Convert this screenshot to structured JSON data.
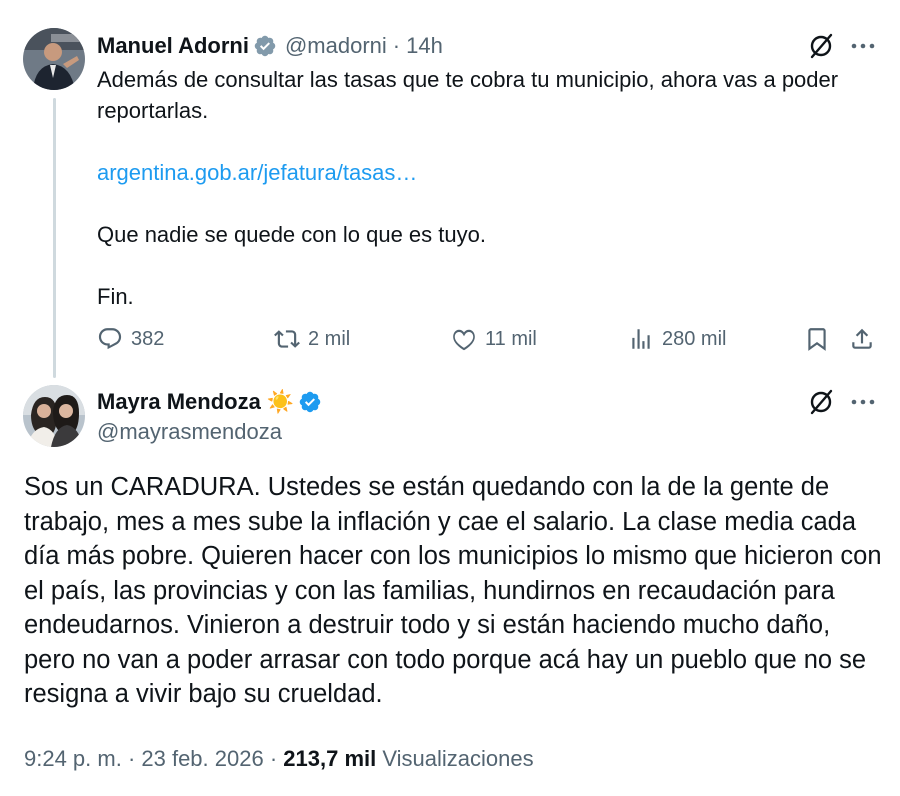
{
  "parent_tweet": {
    "author_name": "Manuel Adorni",
    "handle": "@madorni",
    "separator": "·",
    "time": "14h",
    "lines": [
      "Además de consultar las tasas que te cobra tu municipio, ahora vas a poder reportarlas.",
      "argentina.gob.ar/jefatura/tasas…",
      "Que nadie se quede con lo que es tuyo.",
      "Fin."
    ],
    "actions": {
      "replies": "382",
      "reposts": "2 mil",
      "likes": "11 mil",
      "views": "280 mil"
    }
  },
  "main_tweet": {
    "author_name": "Mayra Mendoza",
    "name_emoji": "☀️",
    "handle": "@mayrasmendoza",
    "text": "Sos un CARADURA. Ustedes se están quedando con la de la gente de trabajo, mes a mes sube la inflación y cae el salario. La clase media cada día más pobre. Quieren hacer con los municipios lo mismo que hicieron con el país, las provincias y con las familias, hundirnos en recaudación para endeudarnos. Vinieron a destruir todo y si están haciendo mucho daño, pero no van a poder arrasar con todo porque acá hay un pueblo que no se resigna a vivir bajo su crueldad.",
    "timestamp": "9:24 p. m. · 23 feb. 2026 ·",
    "views_count": "213,7 mil",
    "views_label": "Visualizaciones"
  },
  "icons": {
    "verified": "verified-badge-icon",
    "grok": "grok-icon",
    "more": "more-icon",
    "reply": "reply-icon",
    "repost": "repost-icon",
    "like": "heart-icon",
    "views": "views-icon",
    "bookmark": "bookmark-icon",
    "share": "share-icon"
  },
  "colors": {
    "text": "#0f1419",
    "secondary": "#536471",
    "link": "#1d9bf0",
    "verified": "#1d9bf0"
  }
}
